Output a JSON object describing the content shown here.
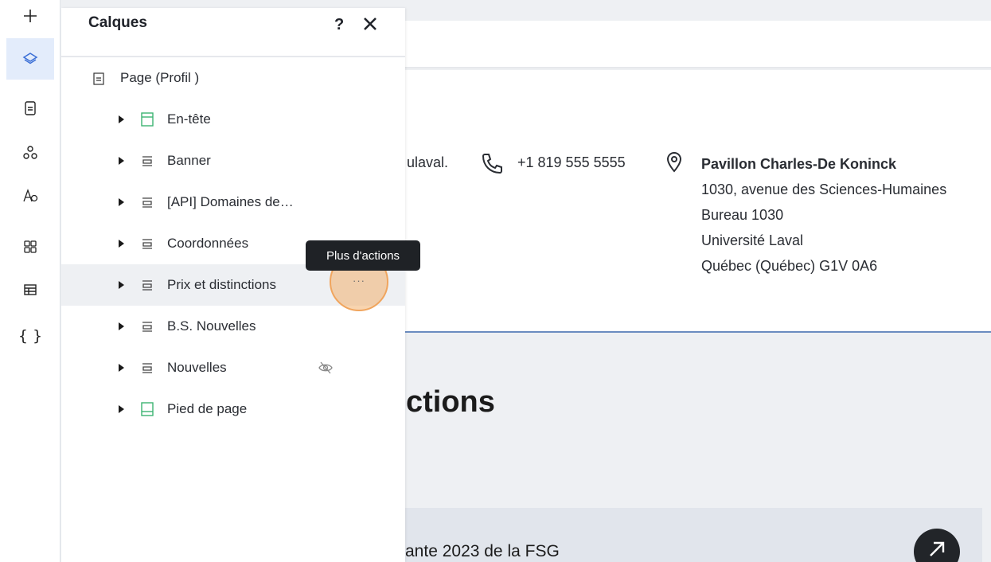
{
  "rail": {
    "items": [
      {
        "name": "add",
        "icon": "plus-icon"
      },
      {
        "name": "layers",
        "icon": "layers-icon",
        "active": true
      },
      {
        "name": "pages",
        "icon": "page-icon"
      },
      {
        "name": "components",
        "icon": "components-icon"
      },
      {
        "name": "fonts",
        "icon": "font-icon"
      },
      {
        "name": "apps",
        "icon": "apps-grid-icon"
      },
      {
        "name": "tables",
        "icon": "table-icon"
      },
      {
        "name": "code",
        "icon": "code-braces-icon",
        "glyph": "{ }"
      }
    ]
  },
  "panel": {
    "title": "Calques",
    "help": "?",
    "root": "Page (Profil )",
    "items": [
      {
        "label": "En-tête",
        "icon": "header-section-icon",
        "color": "#3cb371"
      },
      {
        "label": "Banner",
        "icon": "section-icon"
      },
      {
        "label": "[API] Domaines de…",
        "icon": "section-icon"
      },
      {
        "label": "Coordonnées",
        "icon": "section-icon"
      },
      {
        "label": "Prix et distinctions",
        "icon": "section-icon",
        "hovered": true
      },
      {
        "label": "B.S. Nouvelles",
        "icon": "section-icon"
      },
      {
        "label": "Nouvelles",
        "icon": "section-icon",
        "hidden": true
      },
      {
        "label": "Pied de page",
        "icon": "footer-section-icon",
        "color": "#3cb371"
      }
    ],
    "more_dots": "···",
    "tooltip": "Plus d'actions"
  },
  "canvas": {
    "email_fragment": "ulaval.",
    "phone": "+1 819 555 5555",
    "address": {
      "name": "Pavillon Charles-De Koninck",
      "line1": "1030, avenue des Sciences-Humaines",
      "line2": "Bureau 1030",
      "line3": "Université Laval",
      "line4": "Québec (Québec) G1V 0A6"
    },
    "section_title": "ctions",
    "card_text": "ante 2023 de la FSG"
  },
  "colors": {
    "accent": "#3b6fd6",
    "highlight_ring": "#f0a55e",
    "rule": "#6b8cc0"
  }
}
